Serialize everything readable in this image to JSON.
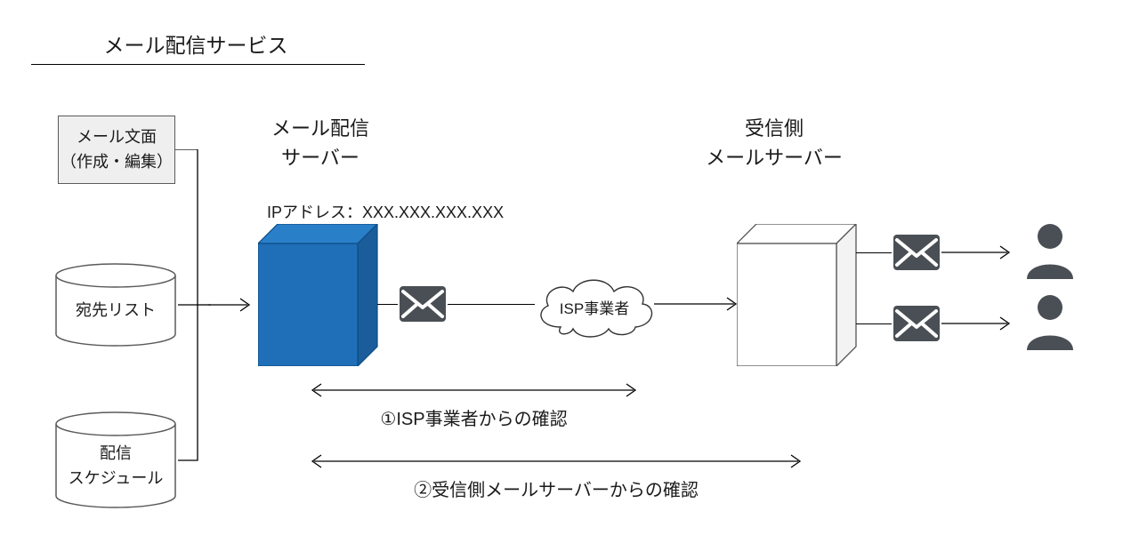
{
  "title": "メール配信サービス",
  "inputs": {
    "content_box": {
      "line1": "メール文面",
      "line2": "（作成・編集）"
    },
    "address_list": "宛先リスト",
    "schedule": {
      "line1": "配信",
      "line2": "スケジュール"
    }
  },
  "delivery_server": {
    "label_line1": "メール配信",
    "label_line2": "サーバー",
    "ip_label": "IPアドレス：XXX.XXX.XXX.XXX"
  },
  "isp": "ISP事業者",
  "receiving_server": {
    "label_line1": "受信側",
    "label_line2": "メールサーバー"
  },
  "checks": {
    "isp_check": "①ISP事業者からの確認",
    "server_check": "②受信側メールサーバーからの確認"
  },
  "colors": {
    "server_blue": "#1f6fb8",
    "server_blue_side": "#1a5d9a",
    "icon_gray": "#4a4f55"
  }
}
